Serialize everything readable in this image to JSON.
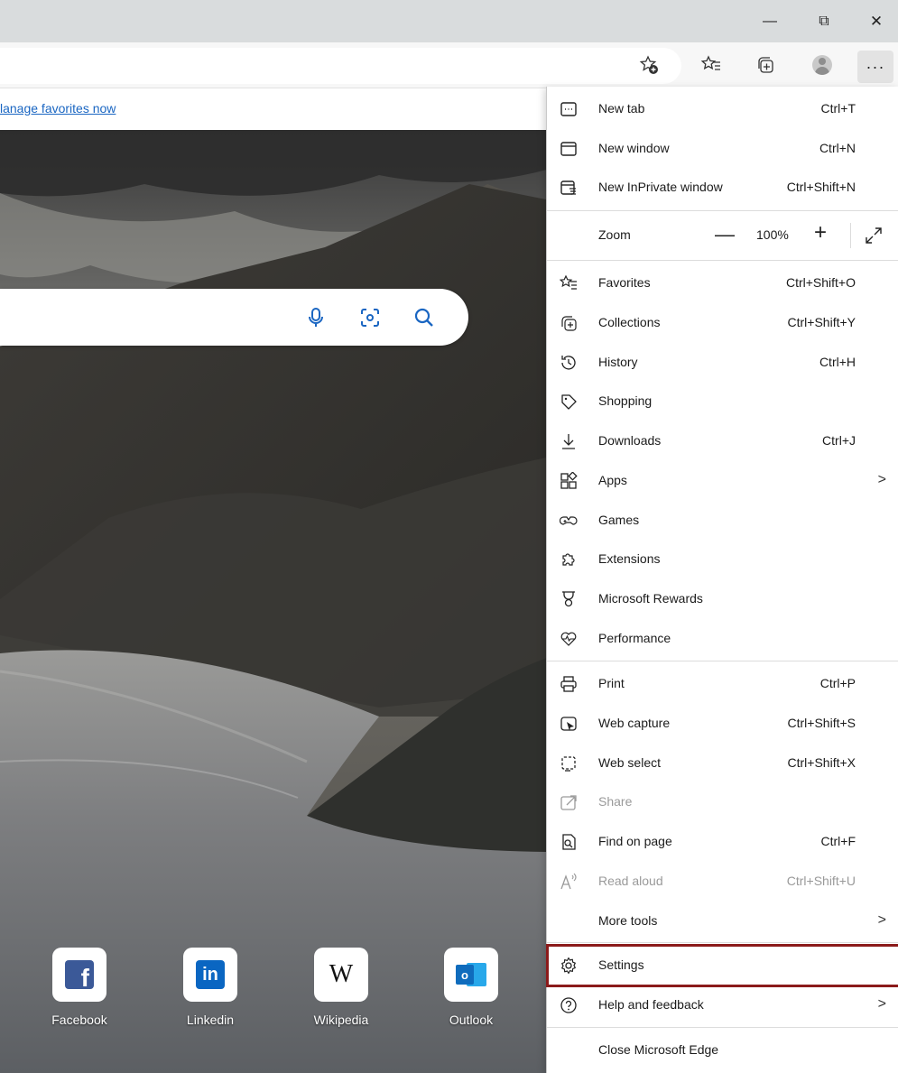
{
  "window_controls": {
    "minimize": "—",
    "maximize": "⧉",
    "close": "✕"
  },
  "toolbar": {
    "more_label": "···"
  },
  "favorites_bar": {
    "link_text": "lanage favorites now"
  },
  "quick_links": [
    {
      "label": "Facebook",
      "glyph": "f",
      "color": "#3b5998"
    },
    {
      "label": "Linkedin",
      "glyph": "in",
      "color": "#0a66c2"
    },
    {
      "label": "Wikipedia",
      "glyph": "W",
      "color": "#111111"
    },
    {
      "label": "Outlook",
      "glyph": "o",
      "color": "#0f6cbd"
    }
  ],
  "menu": {
    "items": [
      {
        "label": "New tab",
        "shortcut": "Ctrl+T"
      },
      {
        "label": "New window",
        "shortcut": "Ctrl+N"
      },
      {
        "label": "New InPrivate window",
        "shortcut": "Ctrl+Shift+N"
      }
    ],
    "zoom": {
      "label": "Zoom",
      "minus": "—",
      "value": "100%",
      "plus": "+"
    },
    "items2": [
      {
        "label": "Favorites",
        "shortcut": "Ctrl+Shift+O"
      },
      {
        "label": "Collections",
        "shortcut": "Ctrl+Shift+Y"
      },
      {
        "label": "History",
        "shortcut": "Ctrl+H"
      },
      {
        "label": "Shopping",
        "shortcut": ""
      },
      {
        "label": "Downloads",
        "shortcut": "Ctrl+J"
      },
      {
        "label": "Apps",
        "shortcut": "",
        "chevron": ">"
      },
      {
        "label": "Games",
        "shortcut": ""
      },
      {
        "label": "Extensions",
        "shortcut": ""
      },
      {
        "label": "Microsoft Rewards",
        "shortcut": ""
      },
      {
        "label": "Performance",
        "shortcut": ""
      }
    ],
    "items3": [
      {
        "label": "Print",
        "shortcut": "Ctrl+P"
      },
      {
        "label": "Web capture",
        "shortcut": "Ctrl+Shift+S"
      },
      {
        "label": "Web select",
        "shortcut": "Ctrl+Shift+X"
      },
      {
        "label": "Share",
        "shortcut": ""
      },
      {
        "label": "Find on page",
        "shortcut": "Ctrl+F"
      },
      {
        "label": "Read aloud",
        "shortcut": "Ctrl+Shift+U"
      },
      {
        "label": "More tools",
        "shortcut": "",
        "chevron": ">"
      }
    ],
    "items4": [
      {
        "label": "Settings"
      },
      {
        "label": "Help and feedback",
        "chevron": ">"
      }
    ],
    "close_label": "Close Microsoft Edge"
  }
}
